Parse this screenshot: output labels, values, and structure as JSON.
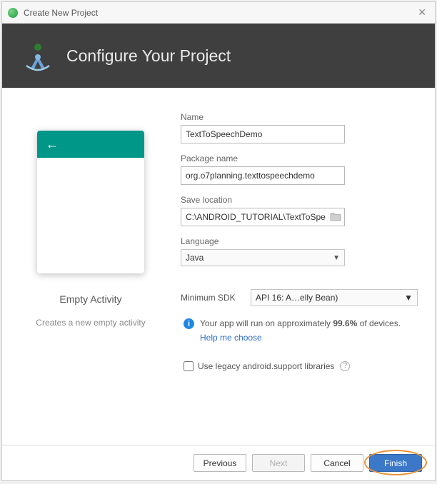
{
  "window": {
    "title": "Create New Project"
  },
  "header": {
    "title": "Configure Your Project"
  },
  "preview": {
    "activity_name": "Empty Activity",
    "activity_desc": "Creates a new empty activity"
  },
  "form": {
    "name_label": "Name",
    "name_value": "TextToSpeechDemo",
    "package_label": "Package name",
    "package_value": "org.o7planning.texttospeechdemo",
    "location_label": "Save location",
    "location_value": "C:\\ANDROID_TUTORIAL\\TextToSpeec",
    "language_label": "Language",
    "language_value": "Java",
    "min_sdk_label": "Minimum SDK",
    "min_sdk_value": "API 16: A…elly Bean)",
    "info_prefix": "Your app will run on approximately ",
    "info_percent": "99.6%",
    "info_suffix": " of devices.",
    "help_link": "Help me choose",
    "legacy_label": "Use legacy android.support libraries"
  },
  "footer": {
    "previous": "Previous",
    "next": "Next",
    "cancel": "Cancel",
    "finish": "Finish"
  }
}
